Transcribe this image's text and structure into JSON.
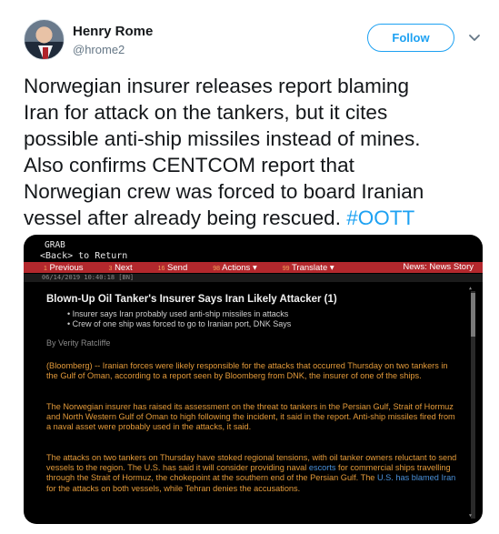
{
  "user": {
    "name": "Henry Rome",
    "handle": "@hrome2",
    "follow_label": "Follow"
  },
  "tweet": {
    "text_lines": [
      "Norwegian insurer releases report blaming",
      "Iran for attack on the tankers, but it cites",
      "possible anti-ship missiles instead of mines.",
      "Also confirms CENTCOM report that",
      "Norwegian crew was forced to board Iranian",
      "vessel after already being rescued. "
    ],
    "hashtag": "#OOTT"
  },
  "terminal": {
    "grab": "GRAB",
    "back": "<Back> to Return",
    "menu": [
      {
        "num": "1",
        "label": "Previous"
      },
      {
        "num": "3",
        "label": "Next"
      },
      {
        "num": "16",
        "label": "Send"
      },
      {
        "num": "98",
        "label": "Actions ▾"
      },
      {
        "num": "99",
        "label": "Translate ▾"
      }
    ],
    "news_label": "News: News Story",
    "date": "06/14/2019 10:40:18 [BN]",
    "headline": "Blown-Up Oil Tanker's Insurer Says Iran Likely Attacker (1)",
    "bullets": [
      "Insurer says Iran probably used anti-ship missiles in attacks",
      "Crew of one ship was forced to go to Iranian port, DNK Says"
    ],
    "byline": "By Verity Ratcliffe",
    "paragraphs": {
      "p1": "(Bloomberg) -- Iranian forces were likely responsible for the attacks that occurred Thursday on two tankers in the Gulf of Oman, according to a report seen by Bloomberg from DNK, the insurer of one of the ships.",
      "p2": "The Norwegian insurer has raised its assessment on the threat to tankers in the Persian Gulf, Strait of Hormuz and North Western Gulf of Oman to high following the incident, it said in the report. Anti-ship missiles fired from a naval asset were probably used in the attacks, it said.",
      "p3_a": "The attacks on two tankers on Thursday have stoked regional tensions, with oil tanker owners reluctant to send vessels to the region. The U.S. has said it will consider providing naval ",
      "p3_link1": "escorts",
      "p3_b": " for commercial ships travelling through the Strait of Hormuz, the chokepoint at the southern end of the Persian Gulf. The ",
      "p3_link2": "U.S. has blamed Iran",
      "p3_c": " for the attacks on both vessels, while Tehran denies the accusations."
    }
  },
  "colors": {
    "accent": "#1da1f2",
    "menubar": "#b3282d",
    "body_text": "#e39a3a"
  }
}
